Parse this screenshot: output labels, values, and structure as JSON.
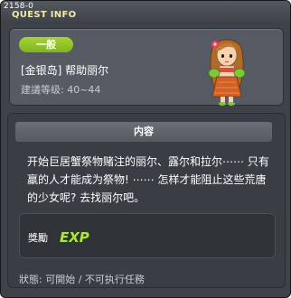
{
  "window": {
    "code": "2158-0",
    "title": "QUEST INFO"
  },
  "quest": {
    "category": "一般",
    "name": "[金银岛] 帮助丽尔",
    "level_requirement": "建議等级: 40~44",
    "npc_portrait_icon": "npc-girl-portrait-icon"
  },
  "content": {
    "header": "内容",
    "lines": [
      "开始巨居蟹祭物赌注的丽尔、露尔和拉尔⋯⋯ 只有",
      "羸的人才能成为祭物! ⋯⋯ 怎样才能阻止这些荒唐",
      "的少女呢? 去找丽尔吧。"
    ]
  },
  "reward": {
    "label": "獎勵",
    "exp_text": "EXP",
    "exp_icon": "exp-icon"
  },
  "status": {
    "text": "狀態: 可開始 / 不可执行任務"
  },
  "colors": {
    "window_bg": "#3f4349",
    "title_text": "#f1e9a8",
    "badge_green": "#8cc22a",
    "exp_green": "#b4e23c"
  }
}
